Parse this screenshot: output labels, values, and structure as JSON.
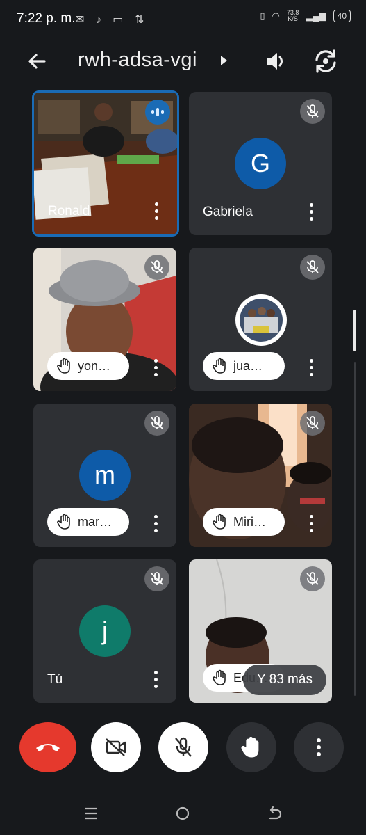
{
  "status_bar": {
    "time": "7:22 p. m.",
    "icons": [
      "mail-icon",
      "tiktok-icon",
      "video-icon",
      "sync-icon"
    ],
    "speed_value": "73,8",
    "speed_unit": "K/S",
    "battery": "40"
  },
  "header": {
    "meeting_code": "rwh-adsa-vgi"
  },
  "tiles": [
    {
      "name": "Ronald",
      "type": "video",
      "speaking": true
    },
    {
      "name": "Gabriela",
      "type": "avatar",
      "initial": "G",
      "color": "#0e5ba8",
      "muted": true
    },
    {
      "name": "yon…",
      "type": "video",
      "hand": true,
      "muted": true
    },
    {
      "name": "jua…",
      "type": "photo",
      "hand": true,
      "muted": true
    },
    {
      "name": "mar…",
      "type": "avatar",
      "initial": "m",
      "color": "#0e5ba8",
      "hand": true,
      "muted": true
    },
    {
      "name": "Miri…",
      "type": "video",
      "hand": true,
      "muted": true
    },
    {
      "name": "Tú",
      "type": "avatar",
      "initial": "j",
      "color": "#0f7b6a",
      "muted": true
    },
    {
      "name": "Edu…",
      "type": "video",
      "hand": true,
      "muted": true
    }
  ],
  "more_label": "Y 83 más",
  "controls": {
    "colors": {
      "end": "#e5392d",
      "light": "#ffffff",
      "dark": "#2e3034"
    }
  }
}
